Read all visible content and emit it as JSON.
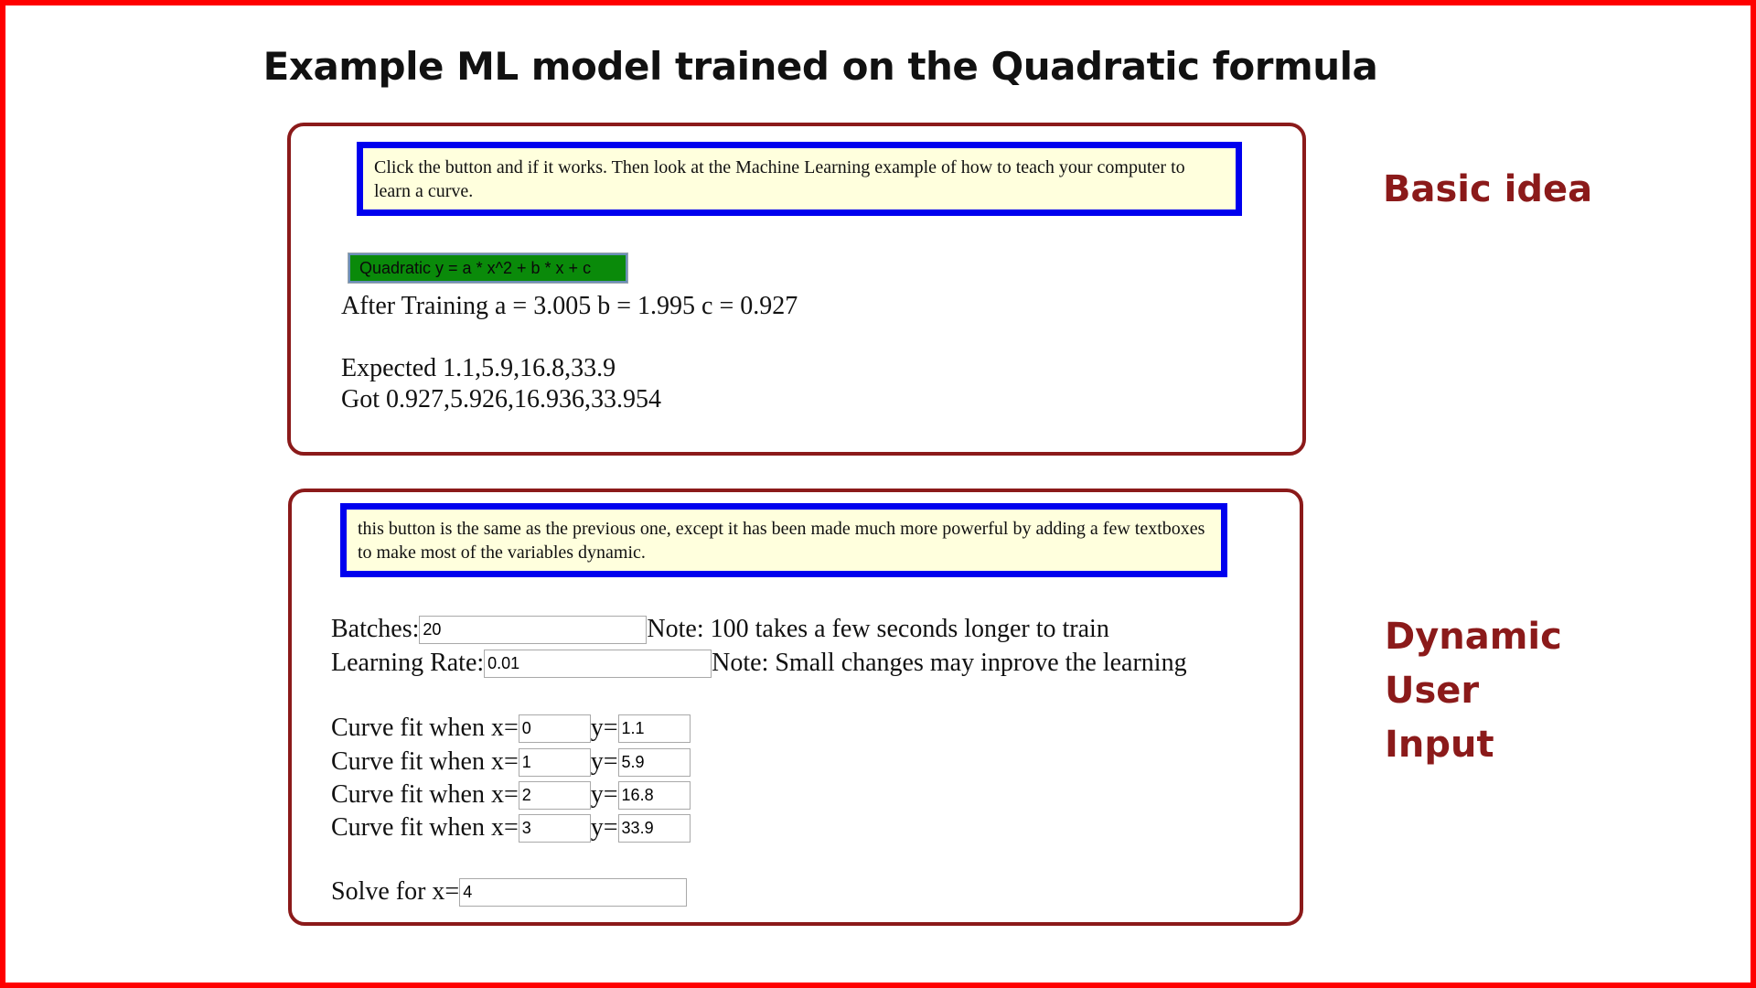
{
  "page_title": "Example ML model trained on the Quadratic formula",
  "basic_panel": {
    "side_label": "Basic idea",
    "note": "Click the button and if it works. Then look at the Machine Learning example of how to teach your computer to learn a curve.",
    "button_label": "Quadratic y = a * x^2 + b * x + c",
    "result": "After Training a = 3.005 b = 1.995 c = 0.927",
    "expected": "Expected 1.1,5.9,16.8,33.9",
    "got": "Got 0.927,5.926,16.936,33.954"
  },
  "dynamic_panel": {
    "side_label_lines": [
      "Dynamic",
      "User",
      "Input"
    ],
    "note": "this button is the same as the previous one, except it has been made much more powerful by adding a few textboxes to make most of the variables dynamic.",
    "batches": {
      "label": "Batches:",
      "value": "20",
      "note": "Note: 100 takes a few seconds longer to train"
    },
    "learning_rate": {
      "label": "Learning Rate:",
      "value": "0.01",
      "note": "Note: Small changes may inprove the learning"
    },
    "curve_points": [
      {
        "x_label": "Curve fit when x=",
        "x": "0",
        "y_label": "y=",
        "y": "1.1"
      },
      {
        "x_label": "Curve fit when x=",
        "x": "1",
        "y_label": "y=",
        "y": "5.9"
      },
      {
        "x_label": "Curve fit when x=",
        "x": "2",
        "y_label": "y=",
        "y": "16.8"
      },
      {
        "x_label": "Curve fit when x=",
        "x": "3",
        "y_label": "y=",
        "y": "33.9"
      }
    ],
    "solve": {
      "label": "Solve for x=",
      "value": "4"
    }
  },
  "colors": {
    "frame": "#ff0000",
    "panel_border": "#8b1a1a",
    "note_border": "#0000ee",
    "note_background": "#ffffdd",
    "button_background": "#0a8a0a",
    "side_label": "#8b1a1a"
  }
}
